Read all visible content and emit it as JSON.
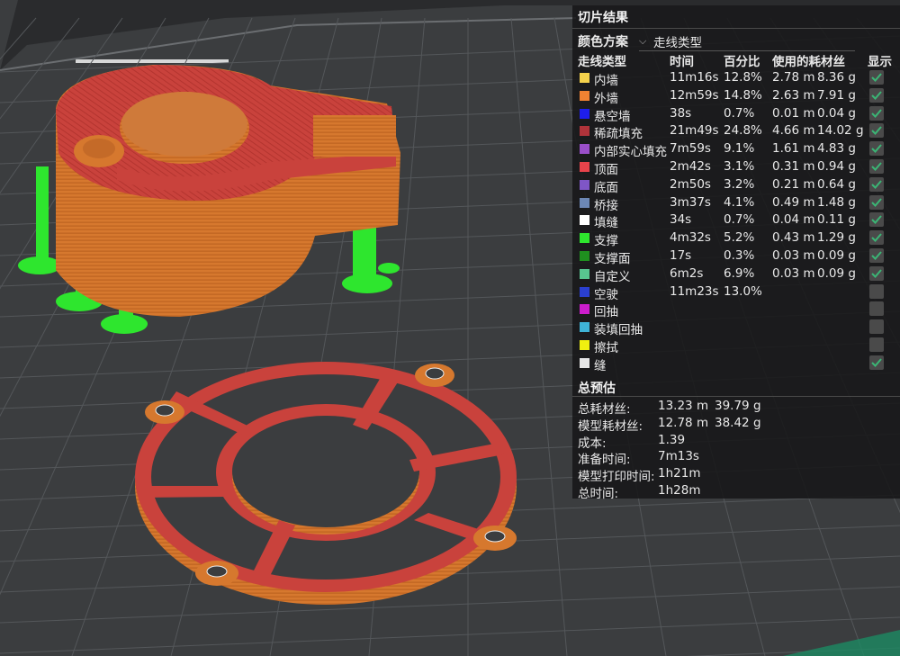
{
  "panel": {
    "title": "切片结果",
    "color_scheme_label": "颜色方案",
    "color_scheme_value": "走线类型",
    "columns": {
      "type": "走线类型",
      "time": "时间",
      "percent": "百分比",
      "filament": "使用的耗材丝",
      "show": "显示"
    },
    "rows": [
      {
        "name": "内墙",
        "time": "11m16s",
        "percent": "12.8%",
        "len": "2.78 m",
        "weight": "8.36 g",
        "color": "#f5d24c",
        "shown": true
      },
      {
        "name": "外墙",
        "time": "12m59s",
        "percent": "14.8%",
        "len": "2.63 m",
        "weight": "7.91 g",
        "color": "#f08232",
        "shown": true
      },
      {
        "name": "悬空墙",
        "time": "38s",
        "percent": "0.7%",
        "len": "0.01 m",
        "weight": "0.04 g",
        "color": "#1e1eeb",
        "shown": true
      },
      {
        "name": "稀疏填充",
        "time": "21m49s",
        "percent": "24.8%",
        "len": "4.66 m",
        "weight": "14.02 g",
        "color": "#b0333a",
        "shown": true
      },
      {
        "name": "内部实心填充",
        "time": "7m59s",
        "percent": "9.1%",
        "len": "1.61 m",
        "weight": "4.83 g",
        "color": "#9a4fc9",
        "shown": true
      },
      {
        "name": "顶面",
        "time": "2m42s",
        "percent": "3.1%",
        "len": "0.31 m",
        "weight": "0.94 g",
        "color": "#e8434b",
        "shown": true
      },
      {
        "name": "底面",
        "time": "2m50s",
        "percent": "3.2%",
        "len": "0.21 m",
        "weight": "0.64 g",
        "color": "#7f56c6",
        "shown": true
      },
      {
        "name": "桥接",
        "time": "3m37s",
        "percent": "4.1%",
        "len": "0.49 m",
        "weight": "1.48 g",
        "color": "#6d88b6",
        "shown": true
      },
      {
        "name": "填缝",
        "time": "34s",
        "percent": "0.7%",
        "len": "0.04 m",
        "weight": "0.11 g",
        "color": "#ffffff",
        "shown": true
      },
      {
        "name": "支撑",
        "time": "4m32s",
        "percent": "5.2%",
        "len": "0.43 m",
        "weight": "1.29 g",
        "color": "#2ee62e",
        "shown": true
      },
      {
        "name": "支撑面",
        "time": "17s",
        "percent": "0.3%",
        "len": "0.03 m",
        "weight": "0.09 g",
        "color": "#1f8f1f",
        "shown": true
      },
      {
        "name": "自定义",
        "time": "6m2s",
        "percent": "6.9%",
        "len": "0.03 m",
        "weight": "0.09 g",
        "color": "#58c690",
        "shown": true
      },
      {
        "name": "空驶",
        "time": "11m23s",
        "percent": "13.0%",
        "len": "",
        "weight": "",
        "color": "#2a3fd0",
        "shown": false
      },
      {
        "name": "回抽",
        "time": "",
        "percent": "",
        "len": "",
        "weight": "",
        "color": "#cc1dcc",
        "shown": false
      },
      {
        "name": "装填回抽",
        "time": "",
        "percent": "",
        "len": "",
        "weight": "",
        "color": "#3fb3d6",
        "shown": false
      },
      {
        "name": "擦拭",
        "time": "",
        "percent": "",
        "len": "",
        "weight": "",
        "color": "#f0f010",
        "shown": false
      },
      {
        "name": "缝",
        "time": "",
        "percent": "",
        "len": "",
        "weight": "",
        "color": "#e6e6e6",
        "shown": true
      }
    ],
    "summary_title": "总预估",
    "summary": [
      {
        "label": "总耗材丝:",
        "value": "13.23 m",
        "extra": "39.79 g"
      },
      {
        "label": "模型耗材丝:",
        "value": "12.78 m",
        "extra": "38.42 g"
      },
      {
        "label": "成本:",
        "value": "1.39",
        "extra": ""
      },
      {
        "label": "准备时间:",
        "value": "7m13s",
        "extra": ""
      },
      {
        "label": "模型打印时间:",
        "value": "1h21m",
        "extra": ""
      },
      {
        "label": "总时间:",
        "value": "1h28m",
        "extra": ""
      }
    ]
  },
  "colors": {
    "plate": "#3b3d3f",
    "grid": "#54575a",
    "model_wall": "#d6782e",
    "model_top": "#c9423c",
    "support": "#2ee62e",
    "panel_bg": "#161617"
  }
}
